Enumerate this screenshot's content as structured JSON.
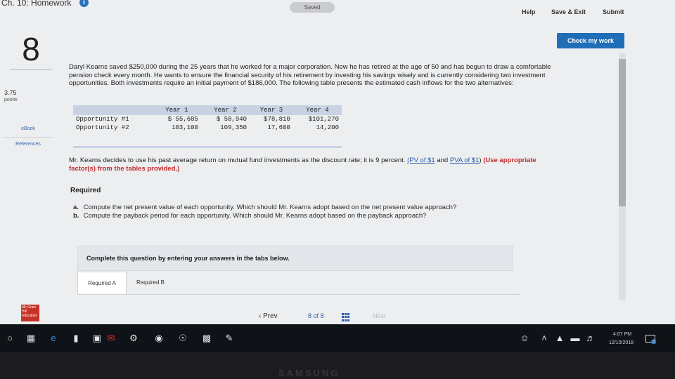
{
  "header": {
    "title": "Ch. 10: Homework",
    "info_glyph": "i",
    "saved_label": "Saved",
    "help_label": "Help",
    "save_exit_label": "Save & Exit",
    "submit_label": "Submit",
    "check_label": "Check my work"
  },
  "sidebar": {
    "question_number": "8",
    "points_value": "3.75",
    "points_label": "points",
    "ebook_label": "eBook",
    "references_label": "References"
  },
  "problem": {
    "text": "Daryl Kearns saved $250,000 during the 25 years that he worked for a major corporation. Now he has retired at the age of 50 and has begun to draw a comfortable pension check every month. He wants to ensure the financial security of his retirement by investing his savings wisely and is currently considering two investment opportunities. Both investments require an initial payment of $186,000. The following table presents the estimated cash inflows for the two alternatives:"
  },
  "table": {
    "headers": [
      "",
      "Year 1",
      "Year 2",
      "Year 3",
      "Year 4"
    ],
    "rows": [
      [
        "Opportunity #1",
        "$ 55,685",
        "$ 58,940",
        "$78,810",
        "$101,270"
      ],
      [
        "Opportunity #2",
        "103,100",
        "109,350",
        "17,600",
        "14,200"
      ]
    ]
  },
  "discount": {
    "text_before": "Mr. Kearns decides to use his past average return on mutual fund investments as the discount rate; it is 9 percent. ",
    "link_pv": "(PV of $1",
    "and_text": " and ",
    "link_pva": "PVA of $1",
    "paren_close": ") ",
    "instruction": "(Use appropriate factor(s) from the tables provided.)"
  },
  "required": {
    "heading": "Required",
    "items": [
      {
        "letter": "a.",
        "text": "Compute the net present value of each opportunity. Which should Mr. Kearns adopt based on the net present value approach?"
      },
      {
        "letter": "b.",
        "text": "Compute the payback period for each opportunity. Which should Mr. Kearns adopt based on the payback approach?"
      }
    ]
  },
  "complete_prompt": "Complete this question by entering your answers in the tabs below.",
  "tabs": [
    {
      "label": "Required A"
    },
    {
      "label": "Required B"
    }
  ],
  "footer": {
    "logo_text": "Mc Graw Hill Education",
    "prev_label": "Prev",
    "page_current": "8",
    "page_of": "of",
    "page_total": "8",
    "next_label": "Next"
  },
  "taskbar": {
    "time": "4:07 PM",
    "date": "12/10/2018",
    "notification_count": "2"
  },
  "bezel_brand": "SAMSUNG"
}
